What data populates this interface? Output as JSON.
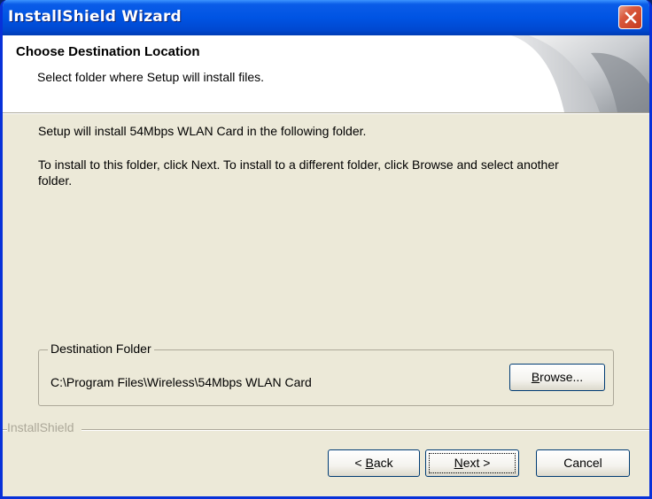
{
  "window": {
    "title": "InstallShield Wizard"
  },
  "header": {
    "title": "Choose Destination Location",
    "subtitle": "Select folder where Setup will install files."
  },
  "body": {
    "line1": "Setup will install 54Mbps WLAN Card in the following folder.",
    "line2": "To install to this folder, click Next. To install to a different folder, click Browse and select another folder."
  },
  "destination": {
    "legend": "Destination Folder",
    "path": "C:\\Program Files\\Wireless\\54Mbps WLAN Card",
    "browse_pre": "",
    "browse_key": "B",
    "browse_post": "rowse..."
  },
  "footer": {
    "brand": "InstallShield",
    "back_pre": "< ",
    "back_key": "B",
    "back_post": "ack",
    "next_key": "N",
    "next_post": "ext >",
    "cancel": "Cancel"
  },
  "colors": {
    "titlebar": "#0054e3",
    "face": "#ece9d8",
    "close": "#d9583c"
  }
}
